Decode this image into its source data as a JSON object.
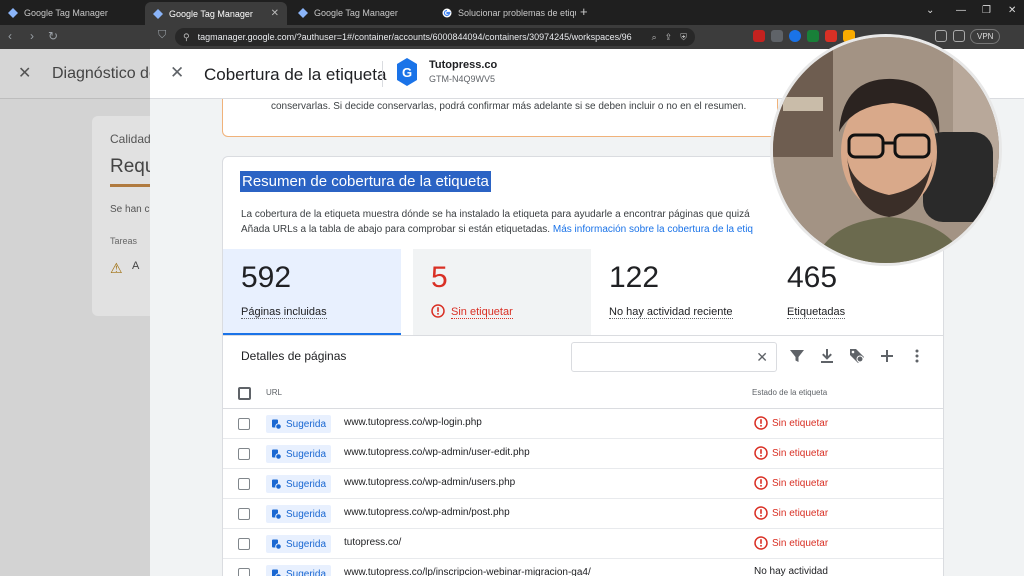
{
  "browser": {
    "tabs": [
      {
        "title": "Google Tag Manager",
        "active": false
      },
      {
        "title": "Google Tag Manager",
        "active": true
      },
      {
        "title": "Google Tag Manager",
        "active": false
      },
      {
        "title": "Solucionar problemas de etiquetas c",
        "active": false
      }
    ],
    "address": "tagmanager.google.com/?authuser=1#/container/accounts/6000844094/containers/30974245/workspaces/96",
    "vpn_label": "VPN",
    "accent": "#1a73e8"
  },
  "background": {
    "title": "Diagnóstico de",
    "card": {
      "label": "Calidad",
      "heading": "Requ",
      "text": "Se han c",
      "section": "Tareas",
      "item": "A"
    }
  },
  "panel": {
    "title": "Cobertura de la etiqueta",
    "account_name": "Tutopress.co",
    "container_id": "GTM-N4Q9WV5",
    "notice_text": "conservarlas. Si decide conservarlas, podrá confirmar más adelante si se deben incluir o no en el resumen.",
    "summary": {
      "title": "Resumen de cobertura de la etiqueta",
      "description": "La cobertura de la etiqueta muestra dónde se ha instalado la etiqueta para ayudarle a encontrar páginas que quizá",
      "description_2": "Añada URLs a la tabla de abajo para comprobar si están etiquetadas.",
      "link_text": "Más información sobre la cobertura de la etiq"
    },
    "stats": [
      {
        "value": "592",
        "label": "Páginas incluidas"
      },
      {
        "value": "5",
        "label": "Sin etiquetar"
      },
      {
        "value": "122",
        "label": "No hay actividad reciente"
      },
      {
        "value": "465",
        "label": "Etiquetadas"
      }
    ],
    "details": {
      "title": "Detalles de páginas",
      "search_placeholder": "",
      "col_url": "URL",
      "col_status": "Estado de la etiqueta",
      "rows": [
        {
          "chip": "Sugerida",
          "url": "www.tutopress.co/wp-login.php",
          "status": "Sin etiquetar"
        },
        {
          "chip": "Sugerida",
          "url": "www.tutopress.co/wp-admin/user-edit.php",
          "status": "Sin etiquetar"
        },
        {
          "chip": "Sugerida",
          "url": "www.tutopress.co/wp-admin/users.php",
          "status": "Sin etiquetar"
        },
        {
          "chip": "Sugerida",
          "url": "www.tutopress.co/wp-admin/post.php",
          "status": "Sin etiquetar"
        },
        {
          "chip": "Sugerida",
          "url": "tutopress.co/",
          "status": "Sin etiquetar"
        },
        {
          "chip": "Sugerida",
          "url": "www.tutopress.co/lp/inscripcion-webinar-migracion-ga4/",
          "status": "No hay actividad"
        }
      ]
    },
    "colors": {
      "error": "#d93025",
      "highlight": "#2b63c4",
      "notice_border": "#f0b27a"
    }
  }
}
